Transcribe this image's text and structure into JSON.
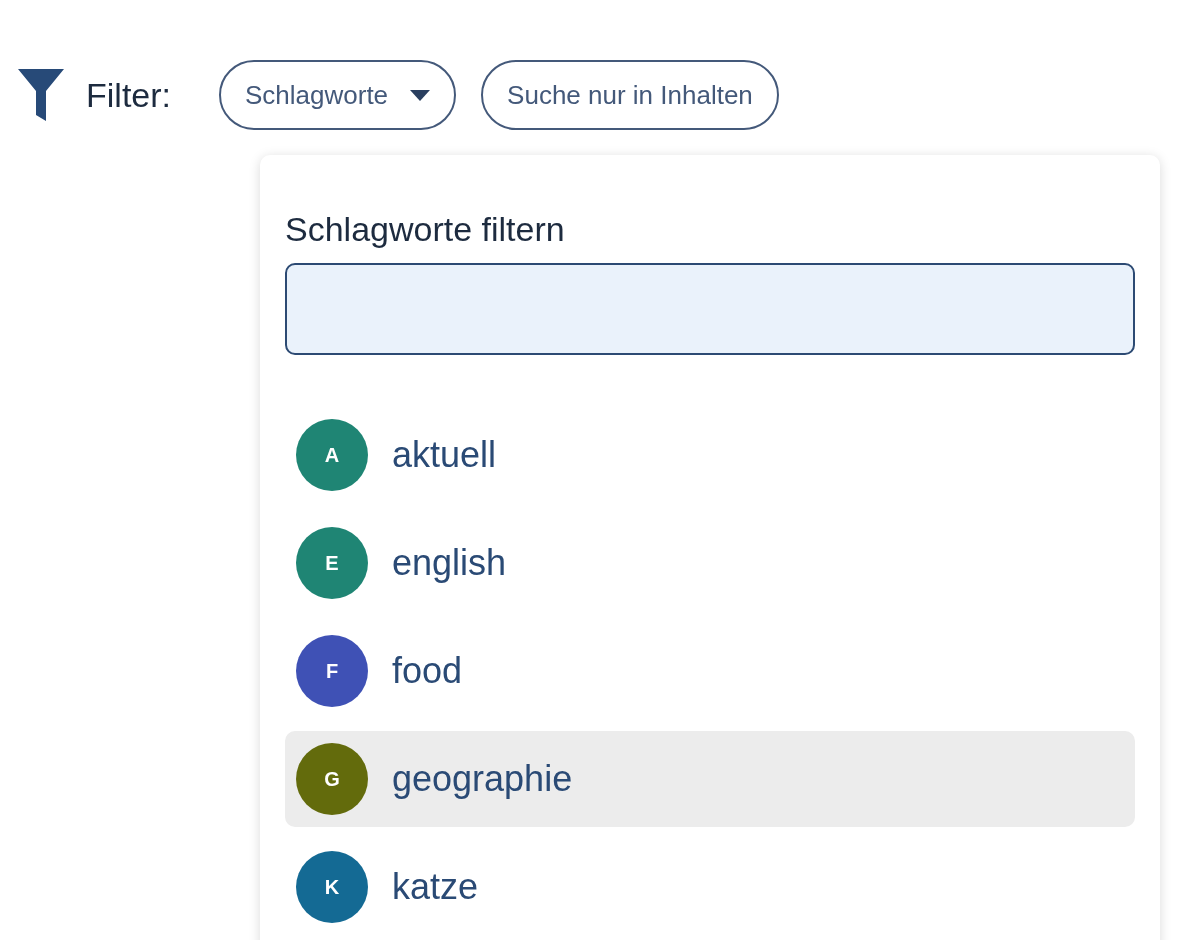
{
  "filter_bar": {
    "label": "Filter:",
    "buttons": [
      {
        "label": "Schlagworte",
        "kind": "dropdown"
      },
      {
        "label": "Suche nur in Inhalten",
        "kind": "plain"
      }
    ]
  },
  "dropdown": {
    "field_label": "Schlagworte filtern",
    "items": [
      {
        "initial": "A",
        "label": "aktuell",
        "color": "#1f8574",
        "highlighted": false
      },
      {
        "initial": "E",
        "label": "english",
        "color": "#1f8574",
        "highlighted": false
      },
      {
        "initial": "F",
        "label": "food",
        "color": "#3f51b5",
        "highlighted": false
      },
      {
        "initial": "G",
        "label": "geographie",
        "color": "#636b0c",
        "highlighted": true
      },
      {
        "initial": "K",
        "label": "katze",
        "color": "#146a94",
        "highlighted": false
      }
    ]
  }
}
